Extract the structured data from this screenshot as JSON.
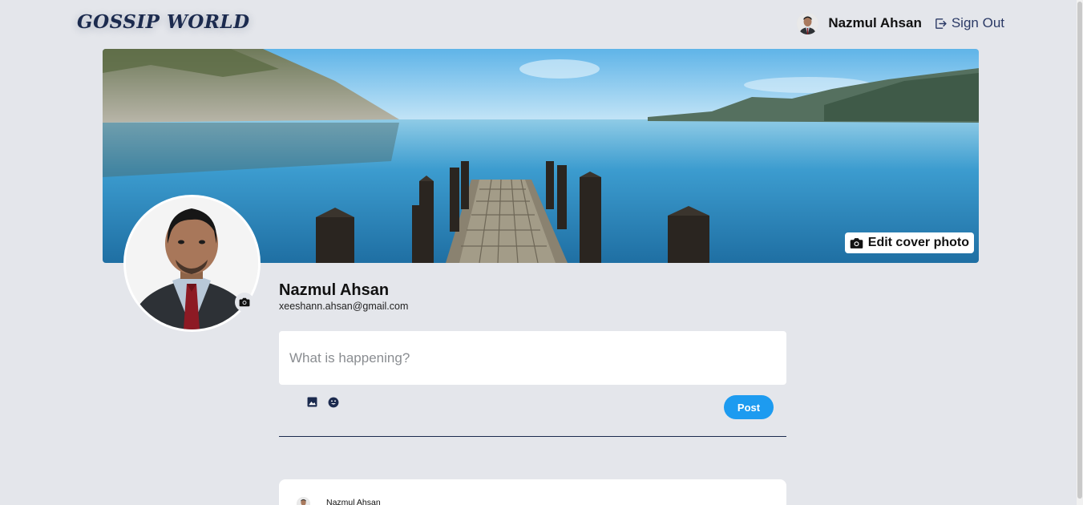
{
  "header": {
    "logo": "GOSSIP WORLD",
    "user_name": "Nazmul Ahsan",
    "signout_label": "Sign Out"
  },
  "cover": {
    "edit_label": "Edit cover photo"
  },
  "profile": {
    "name": "Nazmul Ahsan",
    "email": "xeeshann.ahsan@gmail.com"
  },
  "composer": {
    "placeholder": "What is happening?",
    "post_label": "Post"
  },
  "feed": {
    "posts": [
      {
        "author": "Nazmul Ahsan"
      }
    ]
  },
  "colors": {
    "brand": "#1b2a4e",
    "accent": "#1d9bf0",
    "background": "#e4e6eb"
  },
  "icons": [
    "camera-icon",
    "signout-icon",
    "image-icon",
    "emoji-icon"
  ]
}
